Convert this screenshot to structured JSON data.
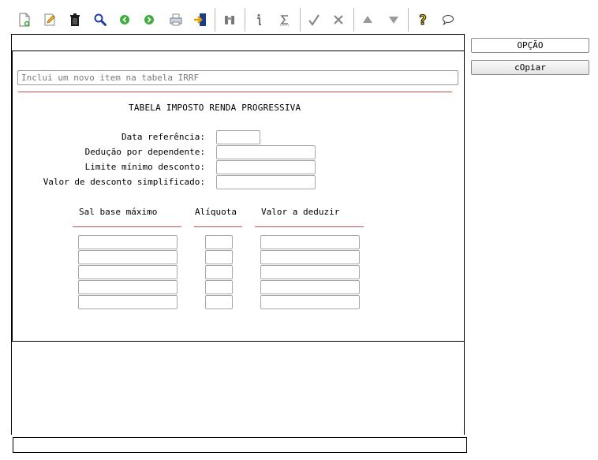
{
  "toolbar": {
    "items": [
      {
        "name": "new-record-icon"
      },
      {
        "name": "edit-icon"
      },
      {
        "name": "delete-icon"
      },
      {
        "name": "search-icon"
      },
      {
        "name": "previous-icon"
      },
      {
        "name": "next-icon"
      },
      {
        "name": "print-icon"
      },
      {
        "name": "exit-icon"
      },
      {
        "name": "binoculars-icon"
      },
      {
        "name": "info-icon"
      },
      {
        "name": "sum-icon"
      },
      {
        "name": "confirm-icon"
      },
      {
        "name": "tools-icon"
      },
      {
        "name": "move-up-icon"
      },
      {
        "name": "move-down-icon"
      },
      {
        "name": "help-icon"
      },
      {
        "name": "comment-icon"
      }
    ]
  },
  "side": {
    "opcao_label": "OPÇÃO",
    "copiar_label": "cOpiar"
  },
  "form": {
    "description_value": "Inclui um novo item na tabela IRRF",
    "title": "TABELA IMPOSTO RENDA PROGRESSIVA",
    "labels": {
      "data_referencia": "Data referência:",
      "deducao_dependente": "Dedução por dependente:",
      "limite_minimo": "Limite mínimo desconto:",
      "valor_desconto": "Valor de desconto simplificado:"
    },
    "columns": {
      "sal_base": "Sal base máximo",
      "aliquota": "Alíquota",
      "valor_deduzir": "Valor a deduzir"
    },
    "row_count": 5
  },
  "colors": {
    "accent_line": "#c0504d",
    "frame": "#000000"
  }
}
